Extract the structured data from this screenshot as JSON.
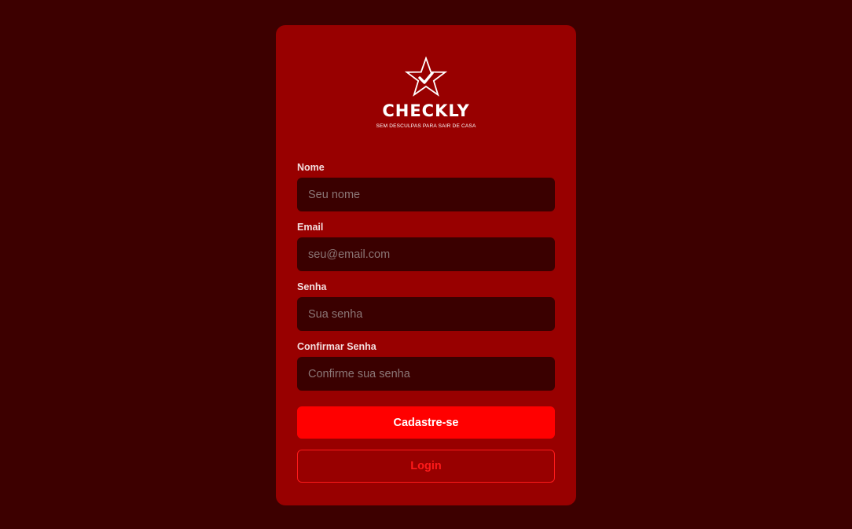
{
  "brand": {
    "name": "CHECKLY",
    "tagline": "SEM DESCULPAS PARA SAIR DE CASA",
    "logo_icon": "star-check-icon"
  },
  "form": {
    "fields": [
      {
        "label": "Nome",
        "placeholder": "Seu nome",
        "value": ""
      },
      {
        "label": "Email",
        "placeholder": "seu@email.com",
        "value": ""
      },
      {
        "label": "Senha",
        "placeholder": "Sua senha",
        "value": ""
      },
      {
        "label": "Confirmar Senha",
        "placeholder": "Confirme sua senha",
        "value": ""
      }
    ],
    "submit_label": "Cadastre-se",
    "login_label": "Login"
  },
  "colors": {
    "background": "#3d0000",
    "card": "#980000",
    "input": "#3a0000",
    "accent": "#ff0000"
  }
}
